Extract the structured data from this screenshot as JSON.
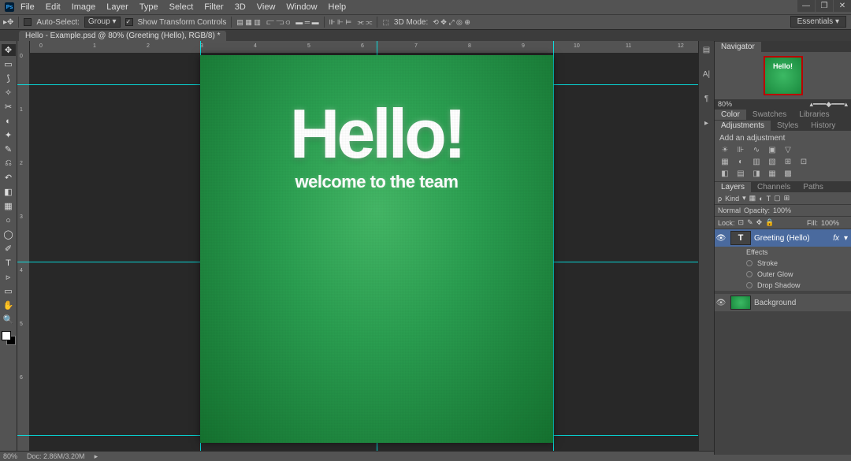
{
  "menu": [
    "File",
    "Edit",
    "Image",
    "Layer",
    "Type",
    "Select",
    "Filter",
    "3D",
    "View",
    "Window",
    "Help"
  ],
  "workspace": "Essentials",
  "doc_tab": "Hello - Example.psd @ 80% (Greeting (Hello), RGB/8) *",
  "options": {
    "auto_select": "Auto-Select:",
    "group": "Group",
    "show_transform": "Show Transform Controls",
    "mode3d": "3D Mode:"
  },
  "ruler_h": [
    "0",
    "1",
    "2",
    "3",
    "4",
    "5",
    "6",
    "7",
    "8",
    "9",
    "10",
    "11",
    "12"
  ],
  "ruler_v": [
    "0",
    "1",
    "2",
    "3",
    "4",
    "5",
    "6"
  ],
  "canvas": {
    "hello": "Hello!",
    "welcome": "welcome to the team"
  },
  "nav": {
    "tab": "Navigator",
    "zoom": "80%"
  },
  "color_tabs": [
    "Color",
    "Swatches",
    "Libraries"
  ],
  "adjust_tabs": [
    "Adjustments",
    "Styles",
    "History"
  ],
  "adjust_title": "Add an adjustment",
  "layers_tabs": [
    "Layers",
    "Channels",
    "Paths"
  ],
  "layers": {
    "kind": "Kind",
    "blend": "Normal",
    "opacity_label": "Opacity:",
    "opacity": "100%",
    "lock": "Lock:",
    "fill_label": "Fill:",
    "fill": "100%",
    "layer1": "Greeting (Hello)",
    "fx": "fx",
    "effects": "Effects",
    "stroke": "Stroke",
    "outer_glow": "Outer Glow",
    "drop_shadow": "Drop Shadow",
    "bg": "Background"
  },
  "status": {
    "zoom": "80%",
    "doc": "Doc: 2.86M/3.20M"
  }
}
